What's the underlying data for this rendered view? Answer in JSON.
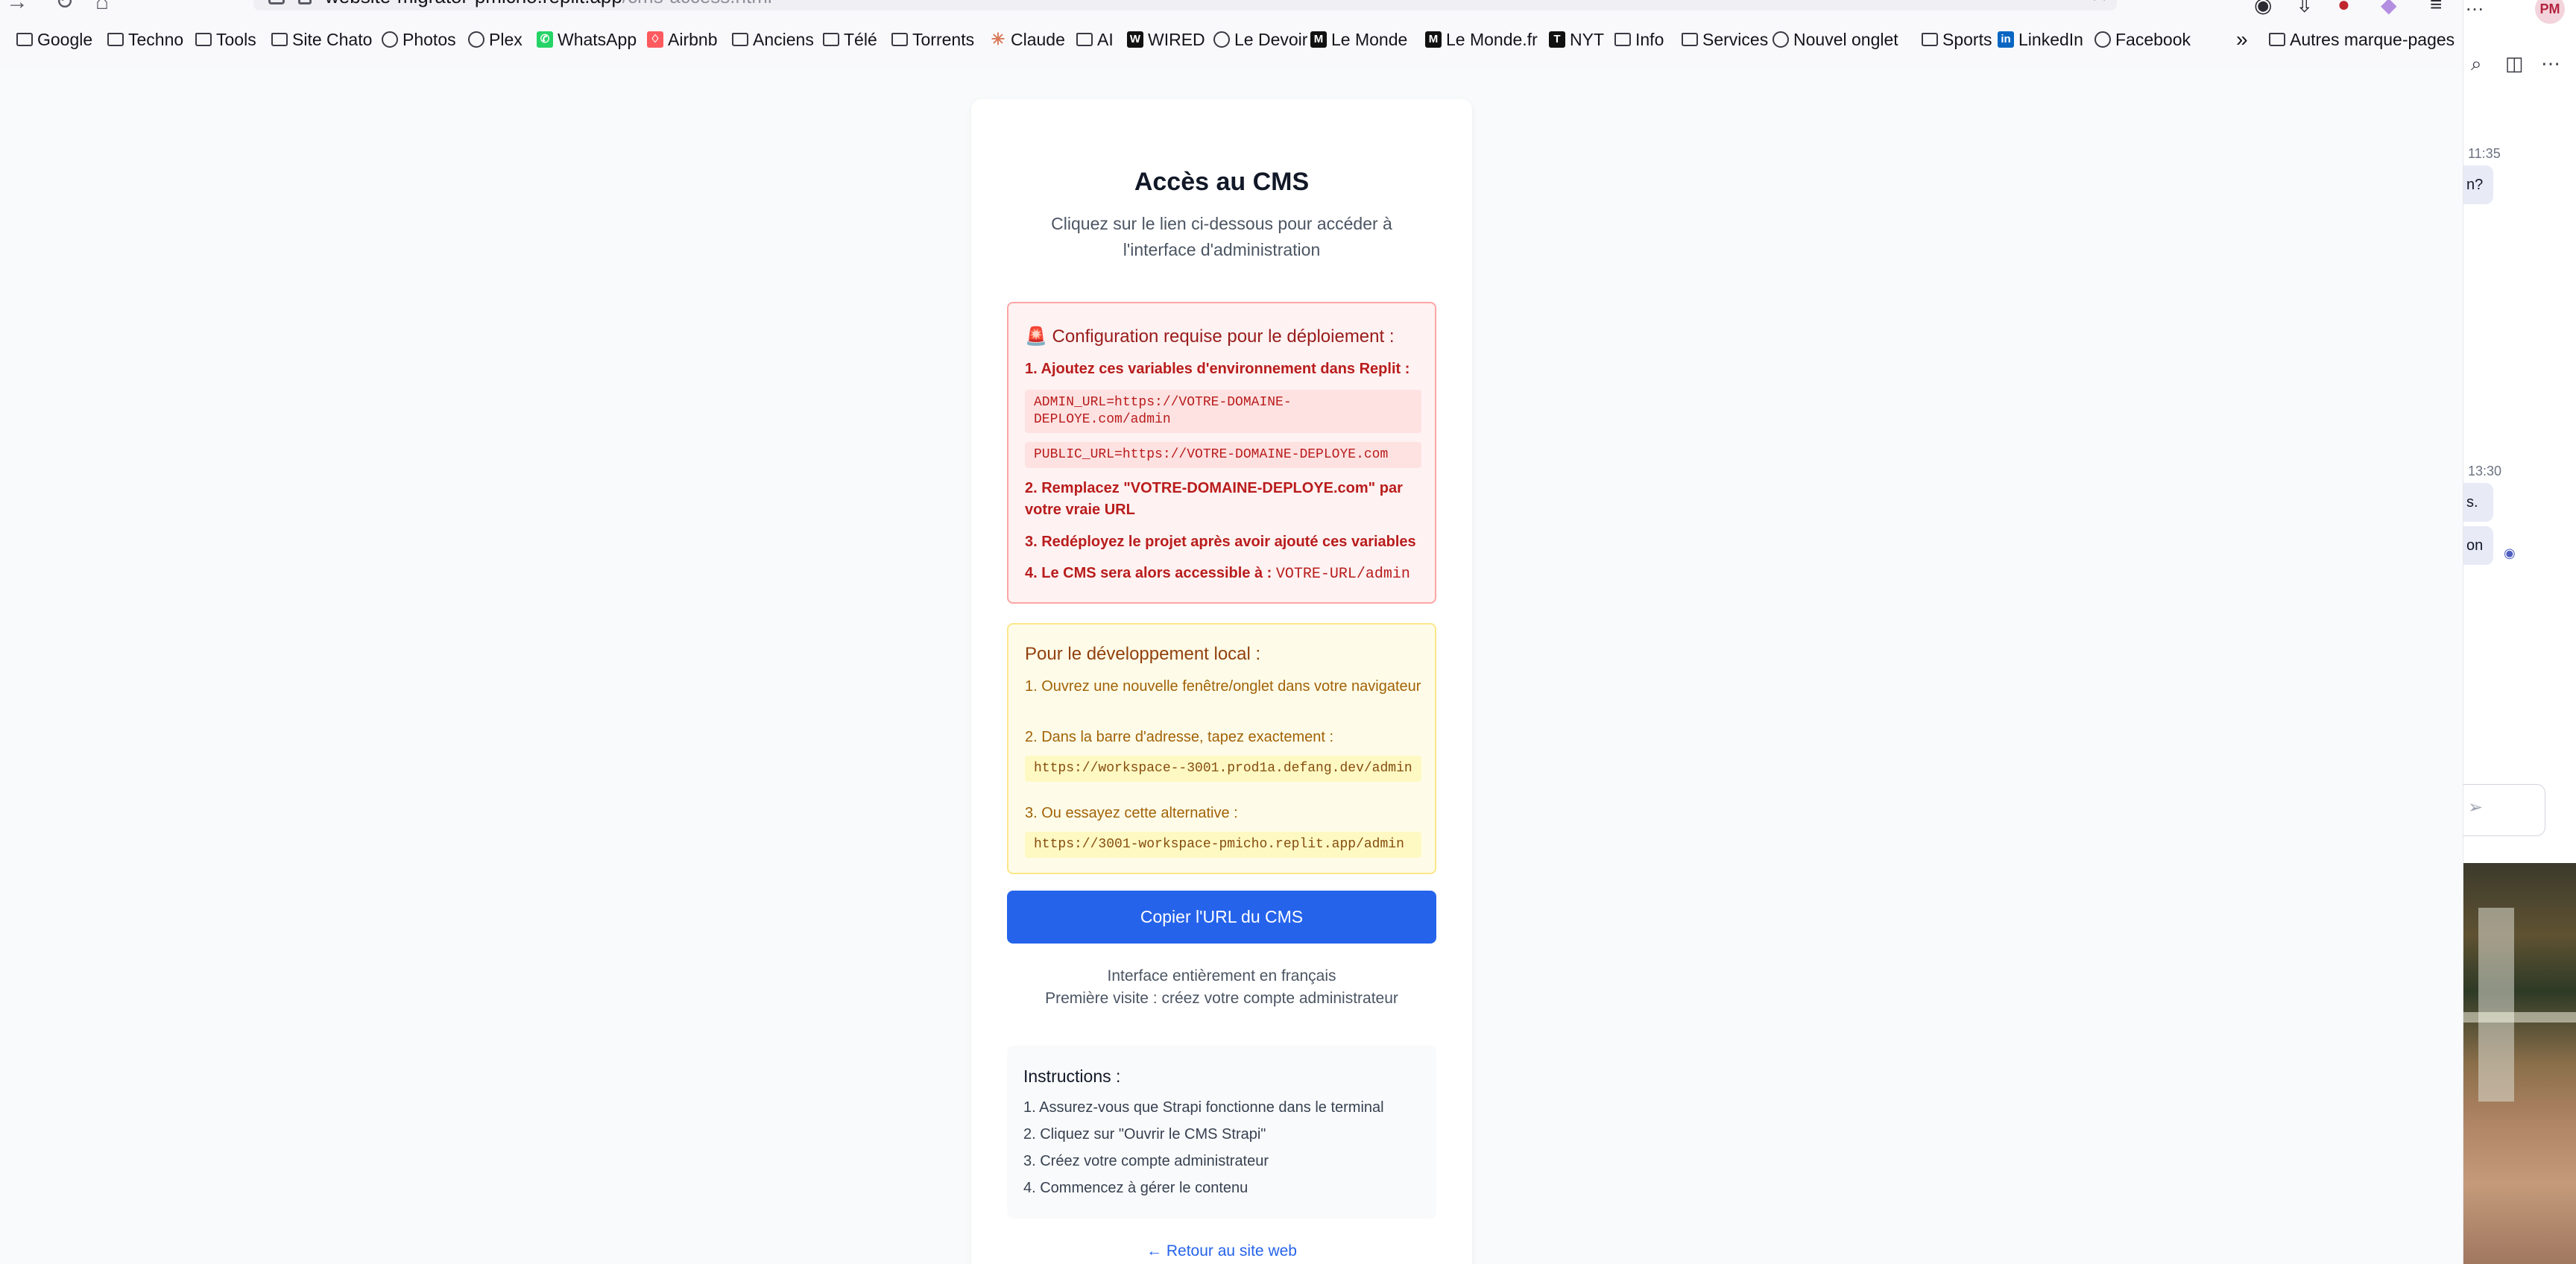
{
  "browser": {
    "url_host": "website-migrator-pmicho.replit.app",
    "url_path": "/cms-access.html",
    "bookmarks": [
      {
        "label": "Google",
        "icon": "folder-icon"
      },
      {
        "label": "Techno",
        "icon": "folder-icon"
      },
      {
        "label": "Tools",
        "icon": "folder-icon"
      },
      {
        "label": "Site Chato",
        "icon": "folder-icon"
      },
      {
        "label": "Photos",
        "icon": "globe-icon"
      },
      {
        "label": "Plex",
        "icon": "globe-icon"
      },
      {
        "label": "WhatsApp",
        "icon": "whatsapp-icon"
      },
      {
        "label": "Airbnb",
        "icon": "airbnb-icon"
      },
      {
        "label": "Anciens",
        "icon": "folder-icon"
      },
      {
        "label": "Télé",
        "icon": "folder-icon"
      },
      {
        "label": "Torrents",
        "icon": "folder-icon"
      },
      {
        "label": "Claude",
        "icon": "claude-icon"
      },
      {
        "label": "AI",
        "icon": "folder-icon"
      },
      {
        "label": "WIRED",
        "icon": "wired-icon"
      },
      {
        "label": "Le Devoir",
        "icon": "globe-icon"
      },
      {
        "label": "Le Monde",
        "icon": "lemonde-icon"
      },
      {
        "label": "Le Monde.fr",
        "icon": "lemonde-icon"
      },
      {
        "label": "NYT",
        "icon": "nyt-icon"
      },
      {
        "label": "Info",
        "icon": "folder-icon"
      },
      {
        "label": "Services",
        "icon": "folder-icon"
      },
      {
        "label": "Nouvel onglet",
        "icon": "globe-icon"
      },
      {
        "label": "Sports",
        "icon": "folder-icon"
      },
      {
        "label": "LinkedIn",
        "icon": "linkedin-icon"
      },
      {
        "label": "Facebook",
        "icon": "globe-icon"
      }
    ],
    "more_bookmarks": "Autres marque-pages",
    "avatar_initials": "PM"
  },
  "page": {
    "title": "Accès au CMS",
    "subtitle": "Cliquez sur le lien ci-dessous pour accéder à l'interface d'administration",
    "deploy": {
      "heading": "🚨 Configuration requise pour le déploiement :",
      "step1": "1. Ajoutez ces variables d'environnement dans Replit :",
      "code1": "ADMIN_URL=https://VOTRE-DOMAINE-DEPLOYE.com/admin",
      "code2": "PUBLIC_URL=https://VOTRE-DOMAINE-DEPLOYE.com",
      "step2": "2. Remplacez \"VOTRE-DOMAINE-DEPLOYE.com\" par votre vraie URL",
      "step3": "3. Redéployez le projet après avoir ajouté ces variables",
      "step4": "4. Le CMS sera alors accessible à :",
      "step4_code": "VOTRE-URL/admin"
    },
    "local": {
      "heading": "Pour le développement local :",
      "step1": "1. Ouvrez une nouvelle fenêtre/onglet dans votre navigateur",
      "step2": "2. Dans la barre d'adresse, tapez exactement :",
      "code1": "https://workspace--3001.prod1a.defang.dev/admin",
      "step3": "3. Ou essayez cette alternative :",
      "code2": "https://3001-workspace-pmicho.replit.app/admin"
    },
    "copy_button": "Copier l'URL du CMS",
    "note1": "Interface entièrement en français",
    "note2": "Première visite : créez votre compte administrateur",
    "instructions": {
      "heading": "Instructions :",
      "items": [
        "1. Assurez-vous que Strapi fonctionne dans le terminal",
        "2. Cliquez sur \"Ouvrir le CMS Strapi\"",
        "3. Créez votre compte administrateur",
        "4. Commencez à gérer le contenu"
      ]
    },
    "back_link": "← Retour au site web"
  },
  "side_panel": {
    "time1": "11:35",
    "bubble1": "n?",
    "time2": "13:30",
    "bubble2": "s.",
    "bubble3": "on"
  }
}
